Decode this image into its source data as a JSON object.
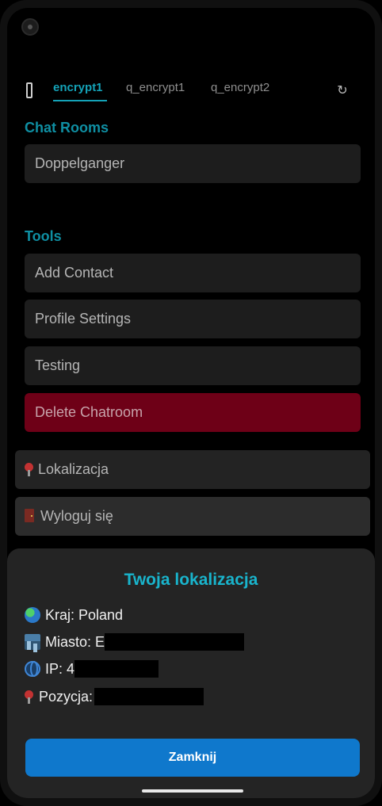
{
  "tabs": {
    "items": [
      {
        "label": "encrypt1",
        "active": true
      },
      {
        "label": "q_encrypt1",
        "active": false
      },
      {
        "label": "q_encrypt2",
        "active": false
      }
    ],
    "menu_icon": "menu-icon",
    "refresh_icon": "refresh-icon"
  },
  "chat_rooms": {
    "title": "Chat Rooms",
    "items": [
      {
        "label": "Doppelganger"
      }
    ]
  },
  "tools": {
    "title": "Tools",
    "items": [
      {
        "label": "Add Contact"
      },
      {
        "label": "Profile Settings"
      },
      {
        "label": "Testing"
      },
      {
        "label": "Delete Chatroom"
      }
    ]
  },
  "bottom_menu": {
    "location": {
      "label": "Lokalizacja",
      "icon": "pin-icon"
    },
    "logout": {
      "label": "Wyloguj się",
      "icon": "door-icon"
    }
  },
  "location_sheet": {
    "title": "Twoja lokalizacja",
    "rows": [
      {
        "icon": "globe-icon",
        "label": "Kraj: Poland"
      },
      {
        "icon": "city-icon",
        "label": "Miasto: E"
      },
      {
        "icon": "network-icon",
        "label": "IP: 4"
      },
      {
        "icon": "pin-icon",
        "label": "Pozycja:"
      }
    ],
    "close_label": "Zamknij"
  },
  "colors": {
    "accent": "#14a3b8",
    "danger": "#6e0017",
    "primary_button": "#0f78cc",
    "background": "#000000",
    "sheet": "#242424"
  }
}
